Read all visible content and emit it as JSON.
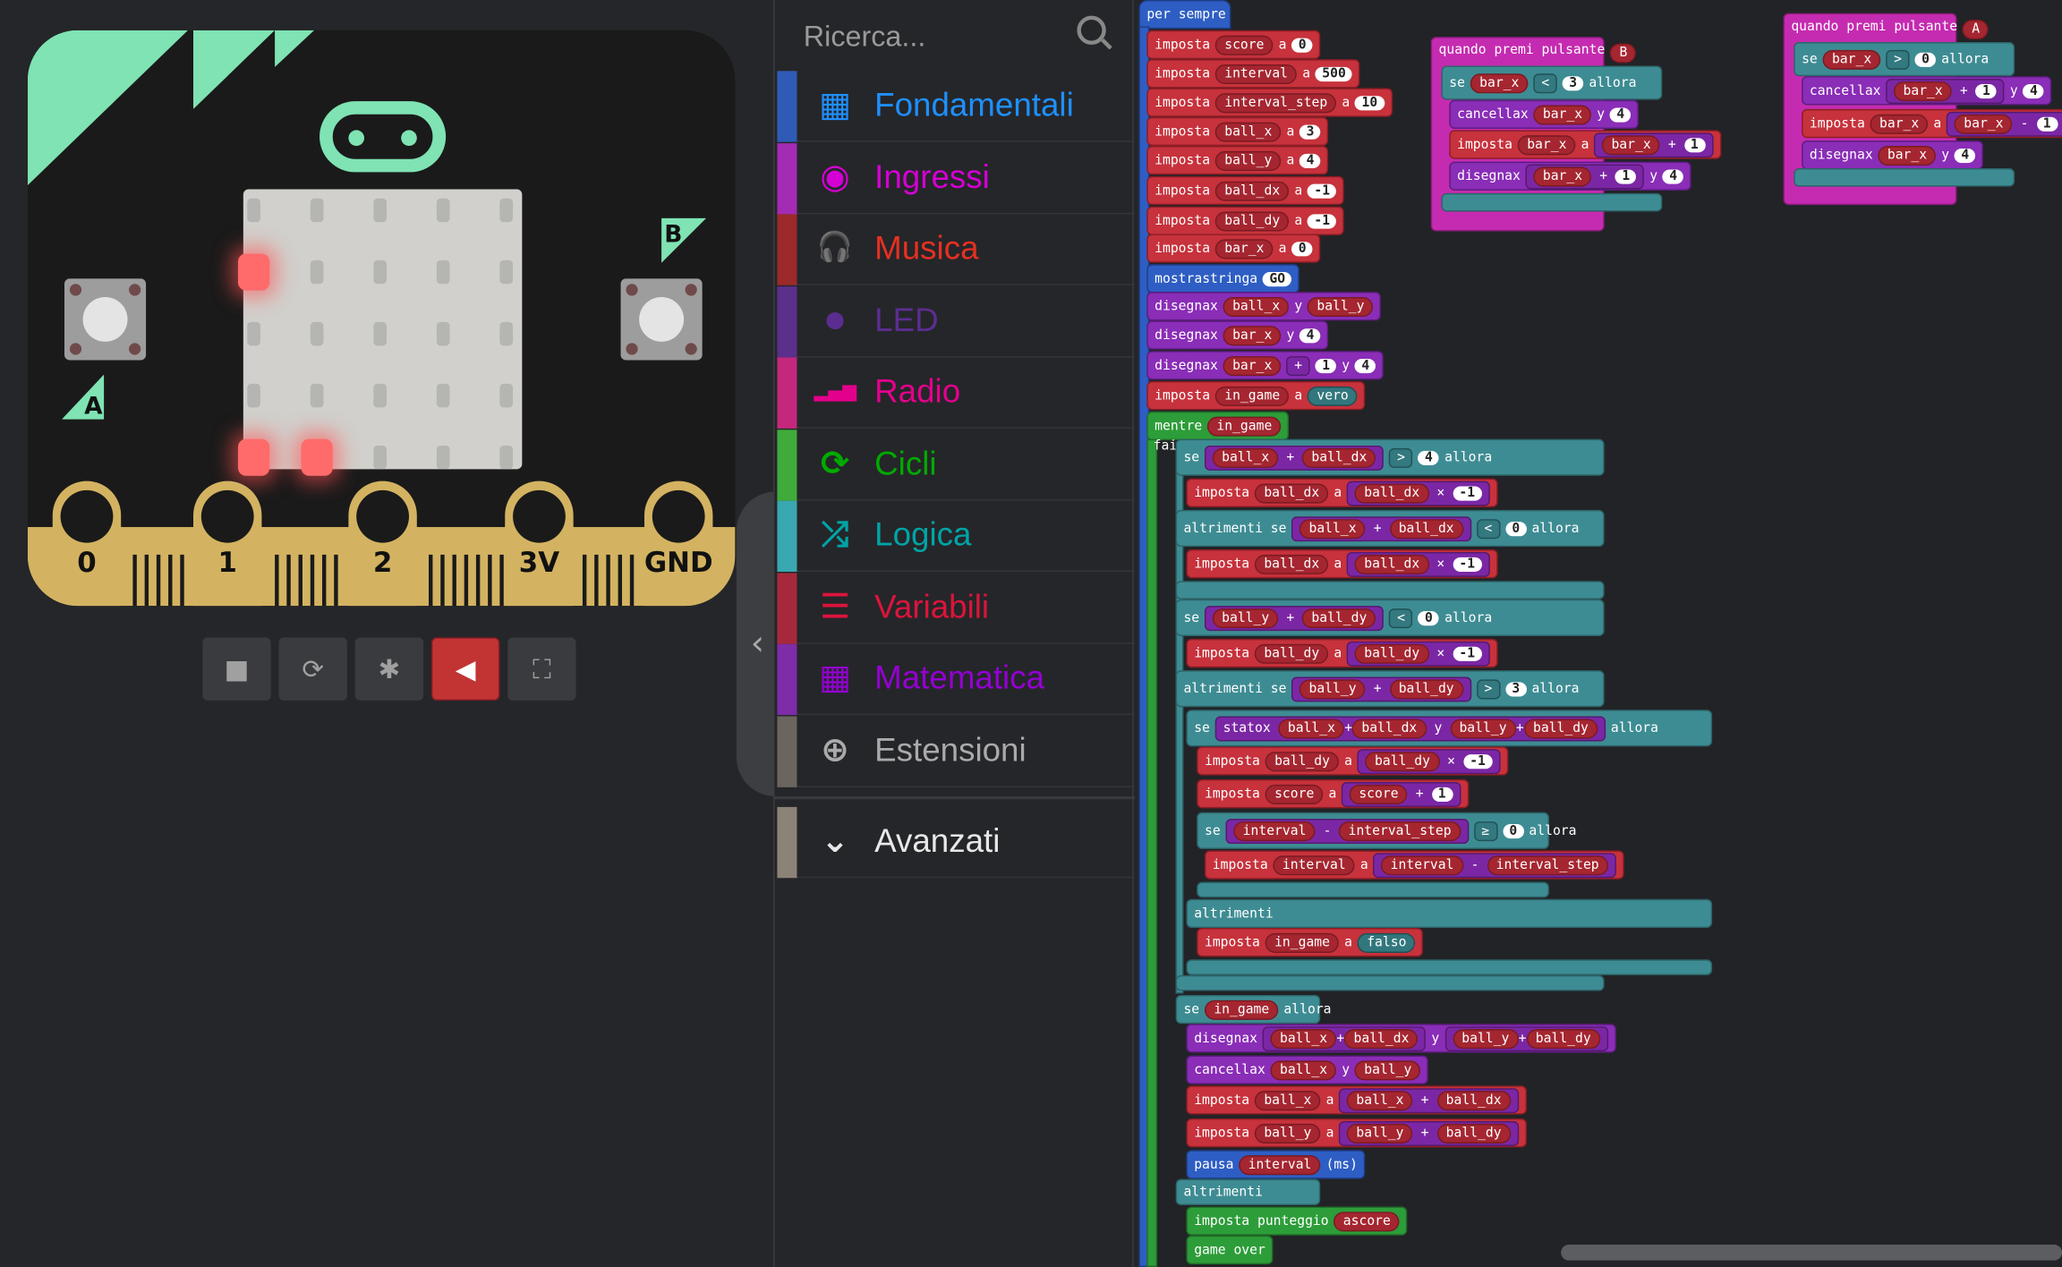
{
  "simulator": {
    "button_a": "A",
    "button_b": "B",
    "pins": [
      "0",
      "1",
      "2",
      "3V",
      "GND"
    ]
  },
  "toolbox": {
    "search_placeholder": "Ricerca...",
    "categories": [
      {
        "label": "Fondamentali",
        "color": "#1e90ff",
        "bar": "#2f5bb7",
        "icon": "grid-icon"
      },
      {
        "label": "Ingressi",
        "color": "#d400d4",
        "bar": "#a42bb3",
        "icon": "target-icon"
      },
      {
        "label": "Musica",
        "color": "#e63022",
        "bar": "#9c2a2a",
        "icon": "headphones-icon"
      },
      {
        "label": "LED",
        "color": "#5c2d91",
        "bar": "#5b2f8c",
        "icon": "toggle-icon"
      },
      {
        "label": "Radio",
        "color": "#e3008c",
        "bar": "#c4287c",
        "icon": "signal-icon"
      },
      {
        "label": "Cicli",
        "color": "#00aa00",
        "bar": "#3fab3a",
        "icon": "loop-icon"
      },
      {
        "label": "Logica",
        "color": "#00a4a6",
        "bar": "#3aa8b0",
        "icon": "shuffle-icon"
      },
      {
        "label": "Variabili",
        "color": "#dc143c",
        "bar": "#a8283b",
        "icon": "list-icon"
      },
      {
        "label": "Matematica",
        "color": "#9400d3",
        "bar": "#7e2ca8",
        "icon": "calculator-icon"
      },
      {
        "label": "Estensioni",
        "color": "#aaaaaa",
        "bar": "#6a655e",
        "icon": "plus-icon"
      },
      {
        "label": "Avanzati",
        "color": "#e8e8e8",
        "bar": "#8c8377",
        "icon": "chevron-down-icon"
      }
    ]
  },
  "colors": {
    "variable": "#c7323c",
    "math": "#8a2db7",
    "basic": "#2e5ec4",
    "logic": "#3e8c93",
    "loops": "#2d9d39",
    "input": "#c52bb0"
  },
  "code": {
    "forever": "per sempre",
    "set": "imposta",
    "to": "a",
    "show": "mostrastringa",
    "plot": "disegnax",
    "y": "y",
    "unplot": "cancellax",
    "while": "mentre",
    "do": "fai",
    "if": "se",
    "then": "allora",
    "elseif": "altrimenti se",
    "else": "altrimenti",
    "pause": "pausa",
    "ms": "(ms)",
    "score_set": "imposta punteggio",
    "gameover": "game over",
    "statox": "statox",
    "on_button": "quando premi pulsante",
    "vars": {
      "score": "score",
      "interval": "interval",
      "interval_step": "interval_step",
      "ball_x": "ball_x",
      "ball_y": "ball_y",
      "ball_dx": "ball_dx",
      "ball_dy": "ball_dy",
      "bar_x": "bar_x",
      "in_game": "in_game"
    },
    "values": {
      "score": "0",
      "interval": "500",
      "step": "10",
      "bx": "3",
      "by": "4",
      "dx": "-1",
      "dy": "-1",
      "bar": "0",
      "str": "GO",
      "four": "4",
      "three": "3",
      "zero": "0",
      "one": "1",
      "m1": "-1",
      "vero": "vero",
      "falso": "falso"
    },
    "ops": {
      "plus": "+",
      "minus": "-",
      "times": "×",
      "gt": ">",
      "lt": "<",
      "ge": "≥"
    },
    "ascore": "ascore",
    "btnB": "B",
    "btnA": "A"
  }
}
